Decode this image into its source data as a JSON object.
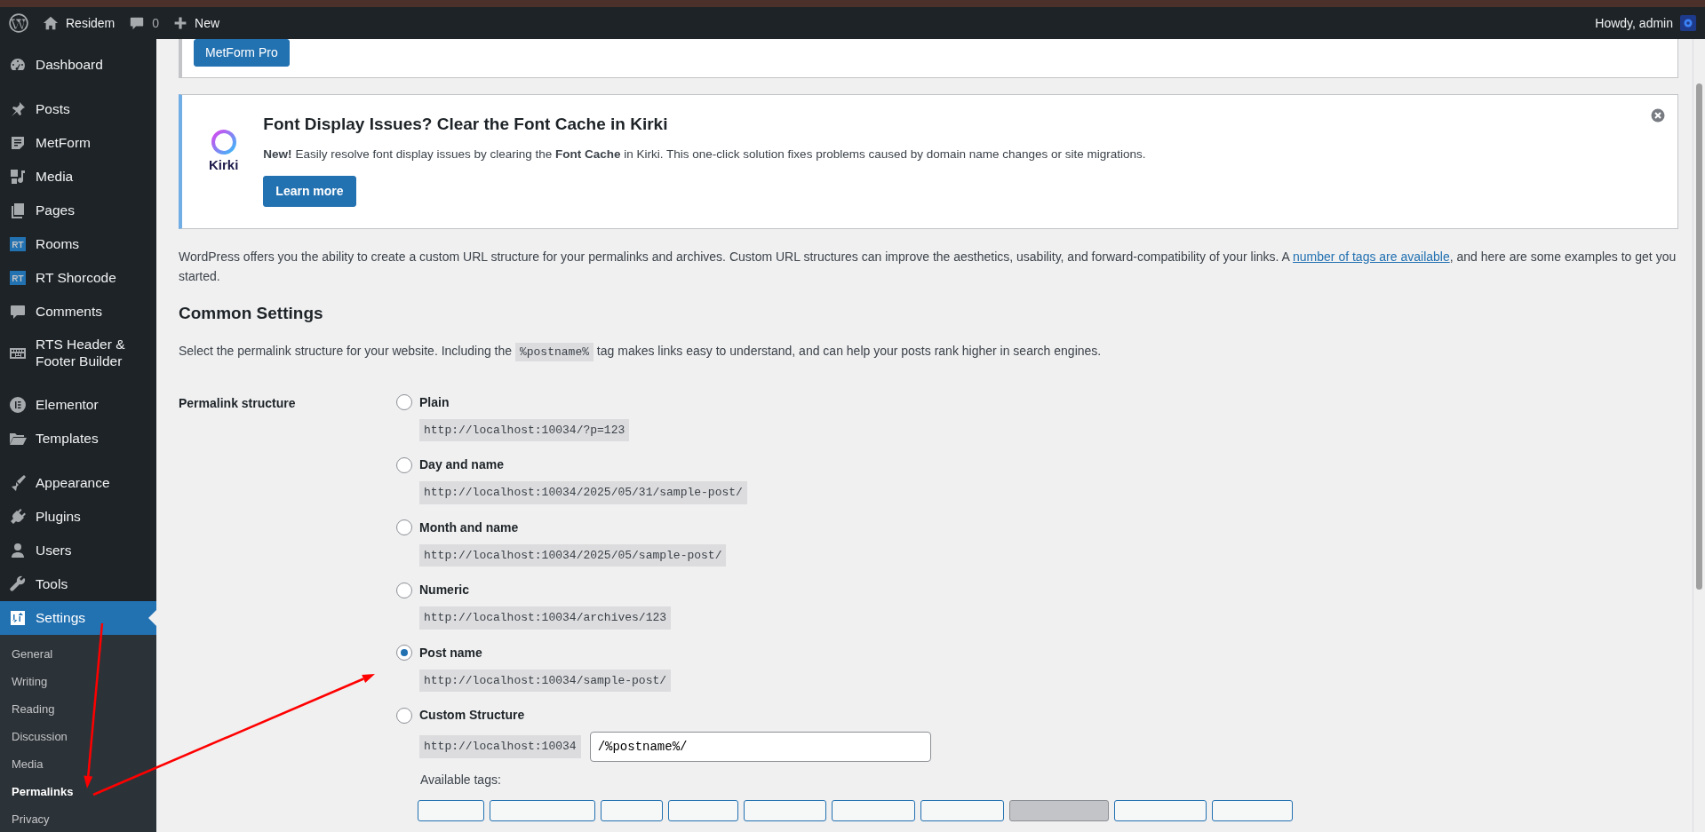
{
  "admin_bar": {
    "site_name": "Residem",
    "comments_count": "0",
    "new_label": "New",
    "greeting": "Howdy, admin"
  },
  "sidebar": {
    "items": [
      {
        "label": "Dashboard",
        "selected": false
      },
      {
        "label": "Posts",
        "selected": false
      },
      {
        "label": "MetForm",
        "selected": false
      },
      {
        "label": "Media",
        "selected": false
      },
      {
        "label": "Pages",
        "selected": false
      },
      {
        "label": "Rooms",
        "selected": false
      },
      {
        "label": "RT Shorcode",
        "selected": false
      },
      {
        "label": "Comments",
        "selected": false
      },
      {
        "label": "RTS Header & Footer Builder",
        "selected": false
      },
      {
        "label": "Elementor",
        "selected": false
      },
      {
        "label": "Templates",
        "selected": false
      },
      {
        "label": "Appearance",
        "selected": false
      },
      {
        "label": "Plugins",
        "selected": false
      },
      {
        "label": "Users",
        "selected": false
      },
      {
        "label": "Tools",
        "selected": false
      },
      {
        "label": "Settings",
        "selected": true
      }
    ],
    "submenu": [
      {
        "label": "General",
        "selected": false
      },
      {
        "label": "Writing",
        "selected": false
      },
      {
        "label": "Reading",
        "selected": false
      },
      {
        "label": "Discussion",
        "selected": false
      },
      {
        "label": "Media",
        "selected": false
      },
      {
        "label": "Permalinks",
        "selected": true
      },
      {
        "label": "Privacy",
        "selected": false
      }
    ]
  },
  "metform_card": {
    "button": "MetForm Pro"
  },
  "notice": {
    "logo_text": "Kirki",
    "title": "Font Display Issues? Clear the Font Cache in Kirki",
    "body": "**New!** Easily resolve font display issues by clearing the **Font Cache** in Kirki. This one-click solution fixes problems caused by domain name changes or site migrations.",
    "button": "Learn more"
  },
  "intro": {
    "text_before": "WordPress offers you the ability to create a custom URL structure for your permalinks and archives. Custom URL structures can improve the aesthetics, usability, and forward-compatibility of your links. A ",
    "link": "number of tags are available",
    "text_after": ", and here are some examples to get you started."
  },
  "heading": "Common Settings",
  "description": {
    "before": "Select the permalink structure for your website. Including the ",
    "code": "%postname%",
    "after": " tag makes links easy to understand, and can help your posts rank higher in search engines."
  },
  "permalink": {
    "label": "Permalink structure",
    "options": [
      {
        "kind": "preset",
        "label": "Plain",
        "example": "http://localhost:10034/?p=123",
        "selected": false
      },
      {
        "kind": "preset",
        "label": "Day and name",
        "example": "http://localhost:10034/2025/05/31/sample-post/",
        "selected": false
      },
      {
        "kind": "preset",
        "label": "Month and name",
        "example": "http://localhost:10034/2025/05/sample-post/",
        "selected": false
      },
      {
        "kind": "preset",
        "label": "Numeric",
        "example": "http://localhost:10034/archives/123",
        "selected": false
      },
      {
        "kind": "preset",
        "label": "Post name",
        "example": "http://localhost:10034/sample-post/",
        "selected": true
      },
      {
        "kind": "custom",
        "label": "Custom Structure",
        "prefix": "http://localhost:10034",
        "value": "/%postname%/",
        "selected": false
      }
    ],
    "available_tags_label": "Available tags:",
    "tag_buttons": [
      {
        "selected": false
      },
      {
        "selected": false
      },
      {
        "selected": false
      },
      {
        "selected": false
      },
      {
        "selected": false
      },
      {
        "selected": false
      },
      {
        "selected": false
      },
      {
        "selected": true
      },
      {
        "selected": false
      },
      {
        "selected": false
      }
    ]
  },
  "annotation_arrows": [
    {
      "color": "#ff0000"
    },
    {
      "color": "#ff0000"
    }
  ]
}
